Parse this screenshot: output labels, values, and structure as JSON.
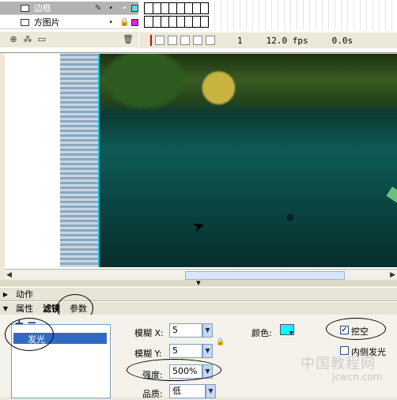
{
  "timeline": {
    "layers": [
      {
        "name": "边框",
        "selected": true,
        "color": "#4fe0e0"
      },
      {
        "name": "方图片",
        "selected": false,
        "color": "#e020e0"
      }
    ],
    "current_frame": "1",
    "frame_rate": "12.0 fps",
    "elapsed": "0.0s"
  },
  "panels": {
    "actions_label": "动作",
    "tabs": [
      "属性",
      "滤镜",
      "参数"
    ]
  },
  "filters": {
    "list": [
      "发光"
    ],
    "blur_x_label": "模糊 X:",
    "blur_x": "5",
    "blur_y_label": "模糊 Y:",
    "blur_y": "5",
    "strength_label": "强度:",
    "strength": "500%",
    "quality_label": "品质:",
    "quality": "低",
    "color_label": "颜色:",
    "glow_color": "#00ffff",
    "knockout_label": "挖空",
    "knockout": true,
    "inner_glow_label": "内侧发光",
    "inner_glow": false
  },
  "watermark": {
    "text": "中国教程网",
    "url": "jcwcn.com"
  }
}
